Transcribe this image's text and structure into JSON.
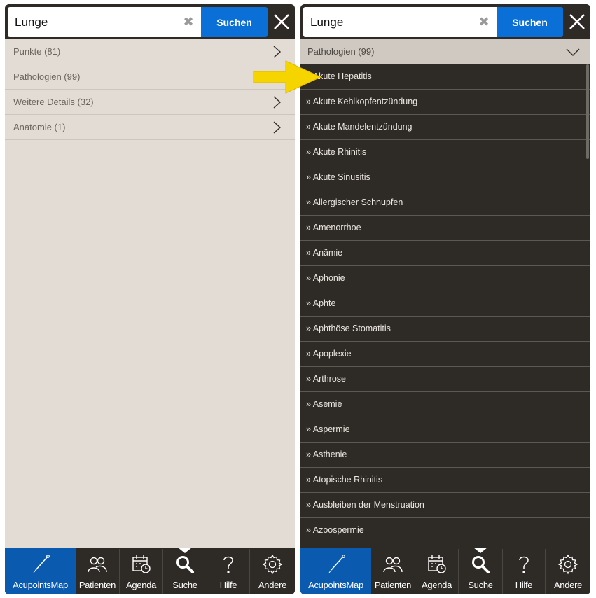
{
  "search": {
    "query": "Lunge",
    "button_label": "Suchen"
  },
  "left_panel": {
    "categories": [
      {
        "label": "Punkte (81)"
      },
      {
        "label": "Pathologien (99)"
      },
      {
        "label": "Weitere Details (32)"
      },
      {
        "label": "Anatomie (1)"
      }
    ]
  },
  "right_panel": {
    "section_header": "Pathologien (99)",
    "items": [
      "» Akute Hepatitis",
      "» Akute Kehlkopfentzündung",
      "» Akute Mandelentzündung",
      "» Akute Rhinitis",
      "» Akute Sinusitis",
      "» Allergischer Schnupfen",
      "» Amenorrhoe",
      "» Anämie",
      "» Aphonie",
      "» Aphte",
      "» Aphthöse Stomatitis",
      "» Apoplexie",
      "» Arthrose",
      "» Asemie",
      "» Aspermie",
      "» Asthenie",
      "» Atopische Rhinitis",
      "» Ausbleiben der Menstruation",
      "» Azoospermie"
    ]
  },
  "tabbar": {
    "tabs": [
      {
        "label": "AcupointsMap",
        "icon": "needle-icon",
        "active": true
      },
      {
        "label": "Patienten",
        "icon": "patients-icon",
        "active": false
      },
      {
        "label": "Agenda",
        "icon": "calendar-clock-icon",
        "active": false
      },
      {
        "label": "Suche",
        "icon": "search-icon",
        "active": false
      },
      {
        "label": "Hilfe",
        "icon": "help-icon",
        "active": false
      },
      {
        "label": "Andere",
        "icon": "gear-icon",
        "active": false
      }
    ]
  },
  "colors": {
    "accent_blue": "#0a6fd6",
    "active_tab": "#0a5ab0",
    "dark_bg": "#2e2b27",
    "light_bg": "#e2dcd5",
    "arrow_yellow": "#f5d400"
  }
}
